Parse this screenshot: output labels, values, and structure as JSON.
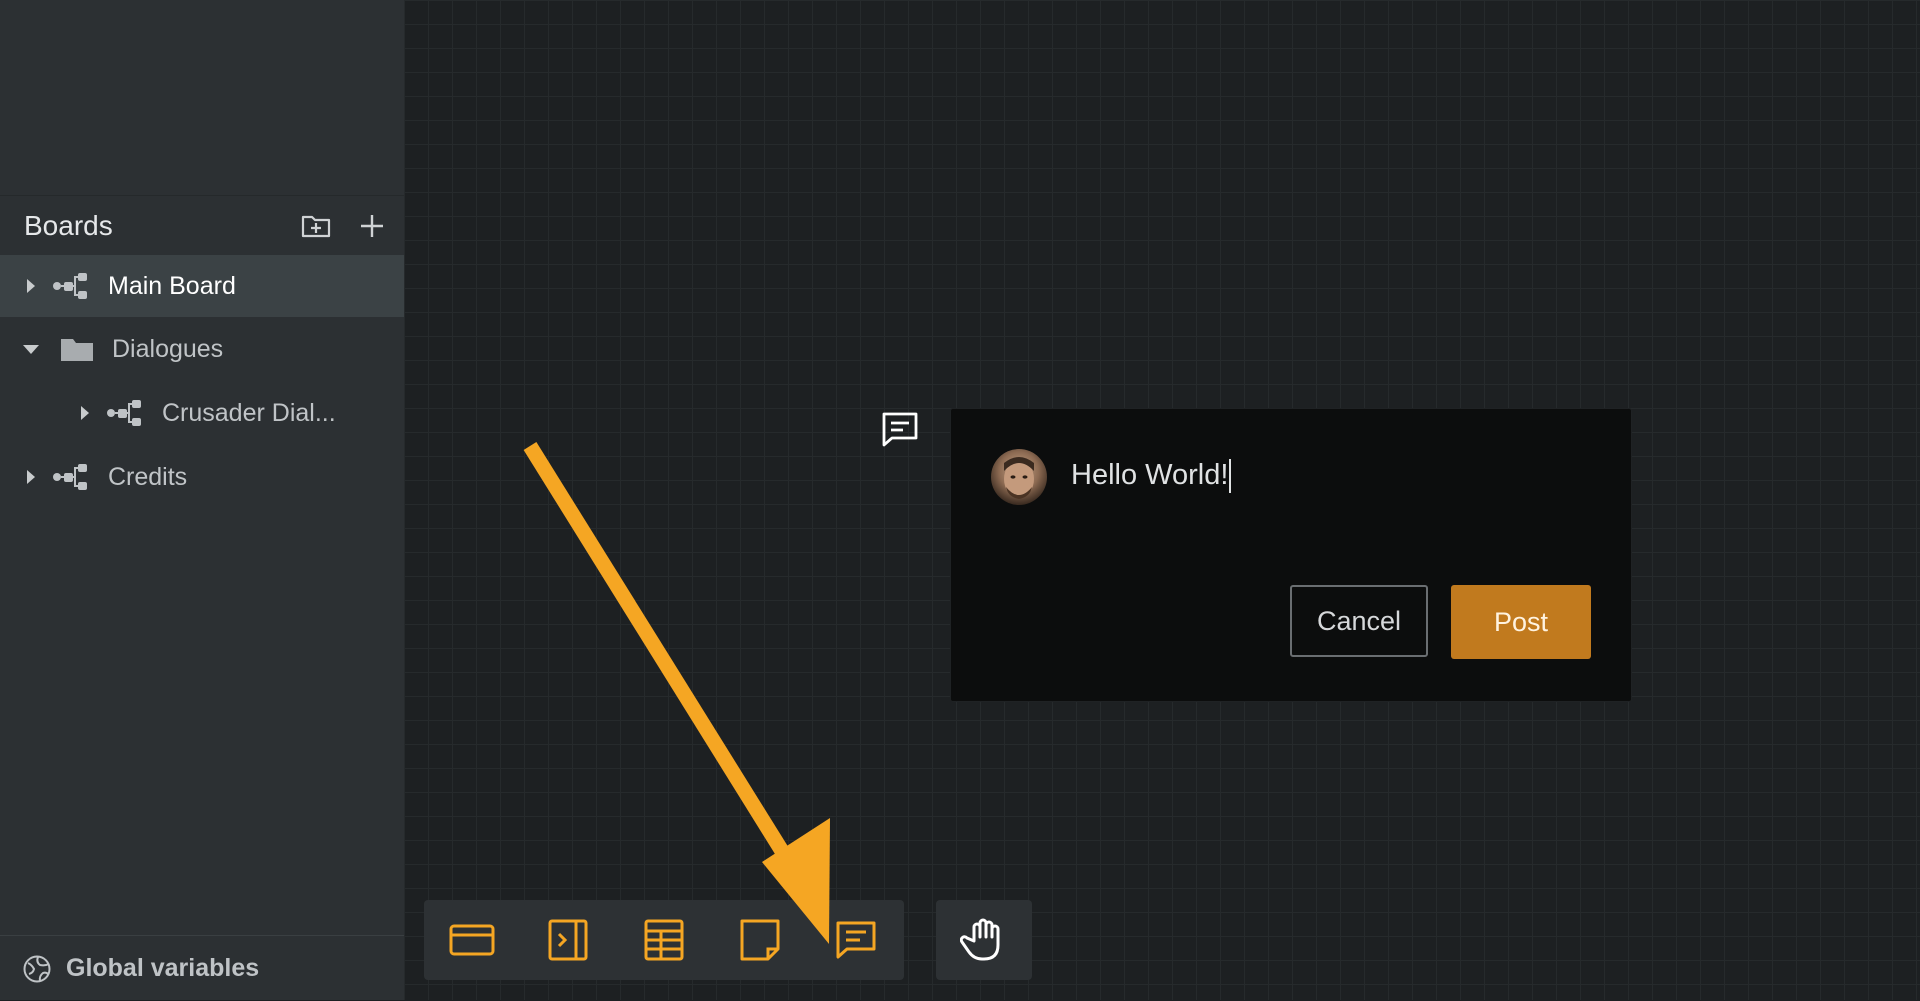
{
  "sidebar": {
    "title": "Boards",
    "new_folder_icon": "folder-plus-icon",
    "add_icon": "plus-icon",
    "items": [
      {
        "label": "Main Board",
        "icon": "board-tree-icon",
        "expanded": false,
        "selected": true
      },
      {
        "label": "Dialogues",
        "icon": "folder-icon",
        "expanded": true,
        "selected": false
      },
      {
        "label": "Crusader Dial...",
        "icon": "board-tree-icon",
        "expanded": false,
        "selected": false
      },
      {
        "label": "Credits",
        "icon": "board-tree-icon",
        "expanded": false,
        "selected": false
      }
    ],
    "footer_label": "Global variables",
    "footer_icon": "globe-icon"
  },
  "comment": {
    "text": "Hello World!",
    "cancel_label": "Cancel",
    "post_label": "Post"
  },
  "toolbar": {
    "tools": [
      "card-icon",
      "sidebar-panel-icon",
      "table-icon",
      "note-icon",
      "comment-icon"
    ],
    "hand_tool": "hand-icon"
  },
  "colors": {
    "accent": "#f5a623",
    "post_button": "#c17a1e",
    "sidebar_bg": "#2c3033",
    "canvas_bg": "#1d2022"
  }
}
